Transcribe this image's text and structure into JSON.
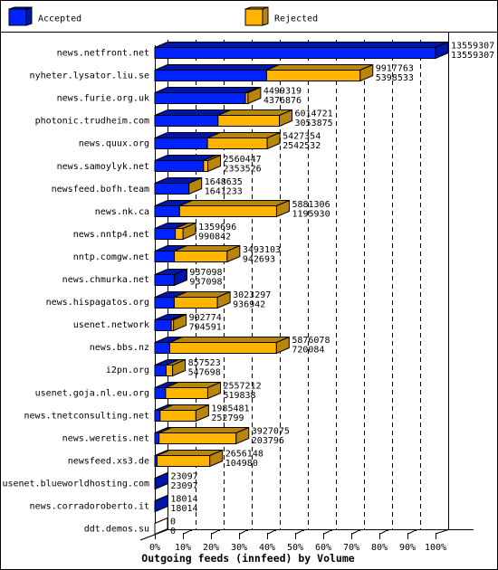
{
  "legend": {
    "accepted_label": "Accepted",
    "rejected_label": "Rejected"
  },
  "chart_data": {
    "type": "bar",
    "orientation": "horizontal",
    "stacked": true,
    "style": "3d",
    "title": "",
    "xlabel": "Outgoing feeds (innfeed) by Volume",
    "ylabel": "",
    "xlim": [
      0,
      100
    ],
    "x_unit": "percent of largest total (13559307)",
    "x_ticks": [
      "0%",
      "10%",
      "20%",
      "30%",
      "40%",
      "50%",
      "60%",
      "70%",
      "80%",
      "90%",
      "100%"
    ],
    "grid": true,
    "legend_position": "top",
    "categories": [
      "news.netfront.net",
      "nyheter.lysator.liu.se",
      "news.furie.org.uk",
      "photonic.trudheim.com",
      "news.quux.org",
      "news.samoylyk.net",
      "newsfeed.bofh.team",
      "news.nk.ca",
      "news.nntp4.net",
      "nntp.comgw.net",
      "news.chmurka.net",
      "news.hispagatos.org",
      "usenet.network",
      "news.bbs.nz",
      "i2pn.org",
      "usenet.goja.nl.eu.org",
      "news.tnetconsulting.net",
      "news.weretis.net",
      "newsfeed.xs3.de",
      "usenet.blueworldhosting.com",
      "news.corradoroberto.it",
      "ddt.demos.su"
    ],
    "series": [
      {
        "name": "Accepted",
        "values": [
          13559307,
          5398533,
          4376876,
          3053875,
          2542532,
          2353526,
          1641233,
          1195930,
          990842,
          942693,
          937098,
          936942,
          794591,
          720084,
          547698,
          519838,
          252799,
          203796,
          104980,
          23097,
          18014,
          0
        ]
      },
      {
        "name": "Rejected",
        "values": [
          0,
          4519230,
          122443,
          2960846,
          2884822,
          206921,
          7402,
          4685376,
          368854,
          2550410,
          0,
          2086355,
          108183,
          5155994,
          309825,
          2037374,
          1732682,
          3723279,
          2551168,
          0,
          0,
          0
        ]
      }
    ],
    "value_labels": {
      "total": [
        "13559307",
        "9917763",
        "4499319",
        "6014721",
        "5427354",
        "2560447",
        "1648635",
        "5881306",
        "1359696",
        "3493103",
        "937098",
        "3023297",
        "902774",
        "5876078",
        "857523",
        "2557212",
        "1985481",
        "3927075",
        "2656148",
        "23097",
        "18014",
        "0"
      ],
      "accepted": [
        "13559307",
        "5398533",
        "4376876",
        "3053875",
        "2542532",
        "2353526",
        "1641233",
        "1195930",
        "990842",
        "942693",
        "937098",
        "936942",
        "794591",
        "720084",
        "547698",
        "519838",
        "252799",
        "203796",
        "104980",
        "23097",
        "18014",
        "0"
      ]
    },
    "colors": {
      "accepted": "#0022ff",
      "accepted_shade": "#0016a8",
      "rejected": "#ffb400",
      "rejected_shade": "#b8860b"
    }
  }
}
